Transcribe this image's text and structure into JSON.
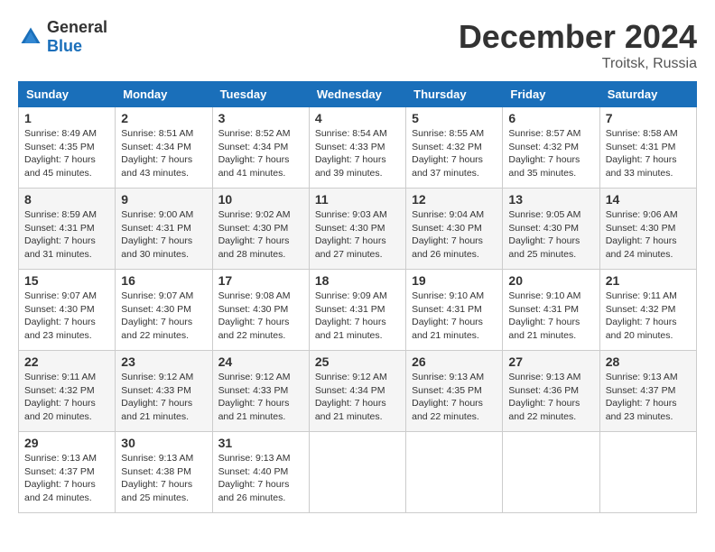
{
  "logo": {
    "text_general": "General",
    "text_blue": "Blue"
  },
  "header": {
    "month": "December 2024",
    "location": "Troitsk, Russia"
  },
  "weekdays": [
    "Sunday",
    "Monday",
    "Tuesday",
    "Wednesday",
    "Thursday",
    "Friday",
    "Saturday"
  ],
  "weeks": [
    [
      {
        "day": "1",
        "sunrise": "Sunrise: 8:49 AM",
        "sunset": "Sunset: 4:35 PM",
        "daylight": "Daylight: 7 hours and 45 minutes."
      },
      {
        "day": "2",
        "sunrise": "Sunrise: 8:51 AM",
        "sunset": "Sunset: 4:34 PM",
        "daylight": "Daylight: 7 hours and 43 minutes."
      },
      {
        "day": "3",
        "sunrise": "Sunrise: 8:52 AM",
        "sunset": "Sunset: 4:34 PM",
        "daylight": "Daylight: 7 hours and 41 minutes."
      },
      {
        "day": "4",
        "sunrise": "Sunrise: 8:54 AM",
        "sunset": "Sunset: 4:33 PM",
        "daylight": "Daylight: 7 hours and 39 minutes."
      },
      {
        "day": "5",
        "sunrise": "Sunrise: 8:55 AM",
        "sunset": "Sunset: 4:32 PM",
        "daylight": "Daylight: 7 hours and 37 minutes."
      },
      {
        "day": "6",
        "sunrise": "Sunrise: 8:57 AM",
        "sunset": "Sunset: 4:32 PM",
        "daylight": "Daylight: 7 hours and 35 minutes."
      },
      {
        "day": "7",
        "sunrise": "Sunrise: 8:58 AM",
        "sunset": "Sunset: 4:31 PM",
        "daylight": "Daylight: 7 hours and 33 minutes."
      }
    ],
    [
      {
        "day": "8",
        "sunrise": "Sunrise: 8:59 AM",
        "sunset": "Sunset: 4:31 PM",
        "daylight": "Daylight: 7 hours and 31 minutes."
      },
      {
        "day": "9",
        "sunrise": "Sunrise: 9:00 AM",
        "sunset": "Sunset: 4:31 PM",
        "daylight": "Daylight: 7 hours and 30 minutes."
      },
      {
        "day": "10",
        "sunrise": "Sunrise: 9:02 AM",
        "sunset": "Sunset: 4:30 PM",
        "daylight": "Daylight: 7 hours and 28 minutes."
      },
      {
        "day": "11",
        "sunrise": "Sunrise: 9:03 AM",
        "sunset": "Sunset: 4:30 PM",
        "daylight": "Daylight: 7 hours and 27 minutes."
      },
      {
        "day": "12",
        "sunrise": "Sunrise: 9:04 AM",
        "sunset": "Sunset: 4:30 PM",
        "daylight": "Daylight: 7 hours and 26 minutes."
      },
      {
        "day": "13",
        "sunrise": "Sunrise: 9:05 AM",
        "sunset": "Sunset: 4:30 PM",
        "daylight": "Daylight: 7 hours and 25 minutes."
      },
      {
        "day": "14",
        "sunrise": "Sunrise: 9:06 AM",
        "sunset": "Sunset: 4:30 PM",
        "daylight": "Daylight: 7 hours and 24 minutes."
      }
    ],
    [
      {
        "day": "15",
        "sunrise": "Sunrise: 9:07 AM",
        "sunset": "Sunset: 4:30 PM",
        "daylight": "Daylight: 7 hours and 23 minutes."
      },
      {
        "day": "16",
        "sunrise": "Sunrise: 9:07 AM",
        "sunset": "Sunset: 4:30 PM",
        "daylight": "Daylight: 7 hours and 22 minutes."
      },
      {
        "day": "17",
        "sunrise": "Sunrise: 9:08 AM",
        "sunset": "Sunset: 4:30 PM",
        "daylight": "Daylight: 7 hours and 22 minutes."
      },
      {
        "day": "18",
        "sunrise": "Sunrise: 9:09 AM",
        "sunset": "Sunset: 4:31 PM",
        "daylight": "Daylight: 7 hours and 21 minutes."
      },
      {
        "day": "19",
        "sunrise": "Sunrise: 9:10 AM",
        "sunset": "Sunset: 4:31 PM",
        "daylight": "Daylight: 7 hours and 21 minutes."
      },
      {
        "day": "20",
        "sunrise": "Sunrise: 9:10 AM",
        "sunset": "Sunset: 4:31 PM",
        "daylight": "Daylight: 7 hours and 21 minutes."
      },
      {
        "day": "21",
        "sunrise": "Sunrise: 9:11 AM",
        "sunset": "Sunset: 4:32 PM",
        "daylight": "Daylight: 7 hours and 20 minutes."
      }
    ],
    [
      {
        "day": "22",
        "sunrise": "Sunrise: 9:11 AM",
        "sunset": "Sunset: 4:32 PM",
        "daylight": "Daylight: 7 hours and 20 minutes."
      },
      {
        "day": "23",
        "sunrise": "Sunrise: 9:12 AM",
        "sunset": "Sunset: 4:33 PM",
        "daylight": "Daylight: 7 hours and 21 minutes."
      },
      {
        "day": "24",
        "sunrise": "Sunrise: 9:12 AM",
        "sunset": "Sunset: 4:33 PM",
        "daylight": "Daylight: 7 hours and 21 minutes."
      },
      {
        "day": "25",
        "sunrise": "Sunrise: 9:12 AM",
        "sunset": "Sunset: 4:34 PM",
        "daylight": "Daylight: 7 hours and 21 minutes."
      },
      {
        "day": "26",
        "sunrise": "Sunrise: 9:13 AM",
        "sunset": "Sunset: 4:35 PM",
        "daylight": "Daylight: 7 hours and 22 minutes."
      },
      {
        "day": "27",
        "sunrise": "Sunrise: 9:13 AM",
        "sunset": "Sunset: 4:36 PM",
        "daylight": "Daylight: 7 hours and 22 minutes."
      },
      {
        "day": "28",
        "sunrise": "Sunrise: 9:13 AM",
        "sunset": "Sunset: 4:37 PM",
        "daylight": "Daylight: 7 hours and 23 minutes."
      }
    ],
    [
      {
        "day": "29",
        "sunrise": "Sunrise: 9:13 AM",
        "sunset": "Sunset: 4:37 PM",
        "daylight": "Daylight: 7 hours and 24 minutes."
      },
      {
        "day": "30",
        "sunrise": "Sunrise: 9:13 AM",
        "sunset": "Sunset: 4:38 PM",
        "daylight": "Daylight: 7 hours and 25 minutes."
      },
      {
        "day": "31",
        "sunrise": "Sunrise: 9:13 AM",
        "sunset": "Sunset: 4:40 PM",
        "daylight": "Daylight: 7 hours and 26 minutes."
      },
      null,
      null,
      null,
      null
    ]
  ]
}
